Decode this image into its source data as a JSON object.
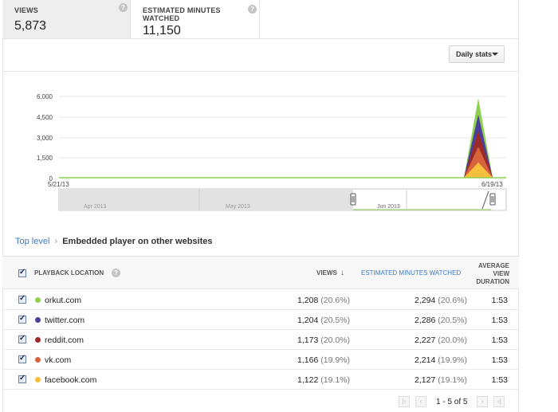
{
  "metrics": {
    "views": {
      "title": "VIEWS",
      "value": "5,873"
    },
    "minutes": {
      "title": "ESTIMATED MINUTES WATCHED",
      "value": "11,150"
    }
  },
  "controls": {
    "daily_stats": "Daily stats"
  },
  "chart_data": {
    "type": "area",
    "x_start_label": "5/21/13",
    "x_end_label": "6/19/13",
    "y_ticks": [
      "6,000",
      "4,500",
      "3,000",
      "1,500",
      "0"
    ],
    "ylim": [
      0,
      6000
    ],
    "series": [
      {
        "name": "orkut.com",
        "color": "#8fd14f",
        "peak": 1208
      },
      {
        "name": "twitter.com",
        "color": "#4a3f9b",
        "peak": 1204
      },
      {
        "name": "reddit.com",
        "color": "#9b2b2b",
        "peak": 1173
      },
      {
        "name": "vk.com",
        "color": "#d8643c",
        "peak": 1166
      },
      {
        "name": "facebook.com",
        "color": "#f6c03c",
        "peak": 1122
      }
    ],
    "navigator_labels": [
      "Apr 2013",
      "May 2013",
      "Jun 2013"
    ]
  },
  "breadcrumb": {
    "root": "Top level",
    "sep": "›",
    "current": "Embedded player on other websites"
  },
  "table": {
    "headers": {
      "location": "PLAYBACK LOCATION",
      "views": "VIEWS",
      "minutes": "ESTIMATED MINUTES WATCHED",
      "duration": "AVERAGE VIEW DURATION"
    },
    "rows": [
      {
        "name": "orkut.com",
        "color": "#8fd14f",
        "views": "1,208",
        "views_pct": "(20.6%)",
        "minutes": "2,294",
        "minutes_pct": "(20.6%)",
        "duration": "1:53"
      },
      {
        "name": "twitter.com",
        "color": "#4a3f9b",
        "views": "1,204",
        "views_pct": "(20.5%)",
        "minutes": "2,286",
        "minutes_pct": "(20.5%)",
        "duration": "1:53"
      },
      {
        "name": "reddit.com",
        "color": "#9b2b2b",
        "views": "1,173",
        "views_pct": "(20.0%)",
        "minutes": "2,227",
        "minutes_pct": "(20.0%)",
        "duration": "1:53"
      },
      {
        "name": "vk.com",
        "color": "#d8643c",
        "views": "1,166",
        "views_pct": "(19.9%)",
        "minutes": "2,214",
        "minutes_pct": "(19.9%)",
        "duration": "1:53"
      },
      {
        "name": "facebook.com",
        "color": "#f6c03c",
        "views": "1,122",
        "views_pct": "(19.1%)",
        "minutes": "2,127",
        "minutes_pct": "(19.1%)",
        "duration": "1:53"
      }
    ]
  },
  "pager": {
    "label": "1 - 5 of 5"
  }
}
